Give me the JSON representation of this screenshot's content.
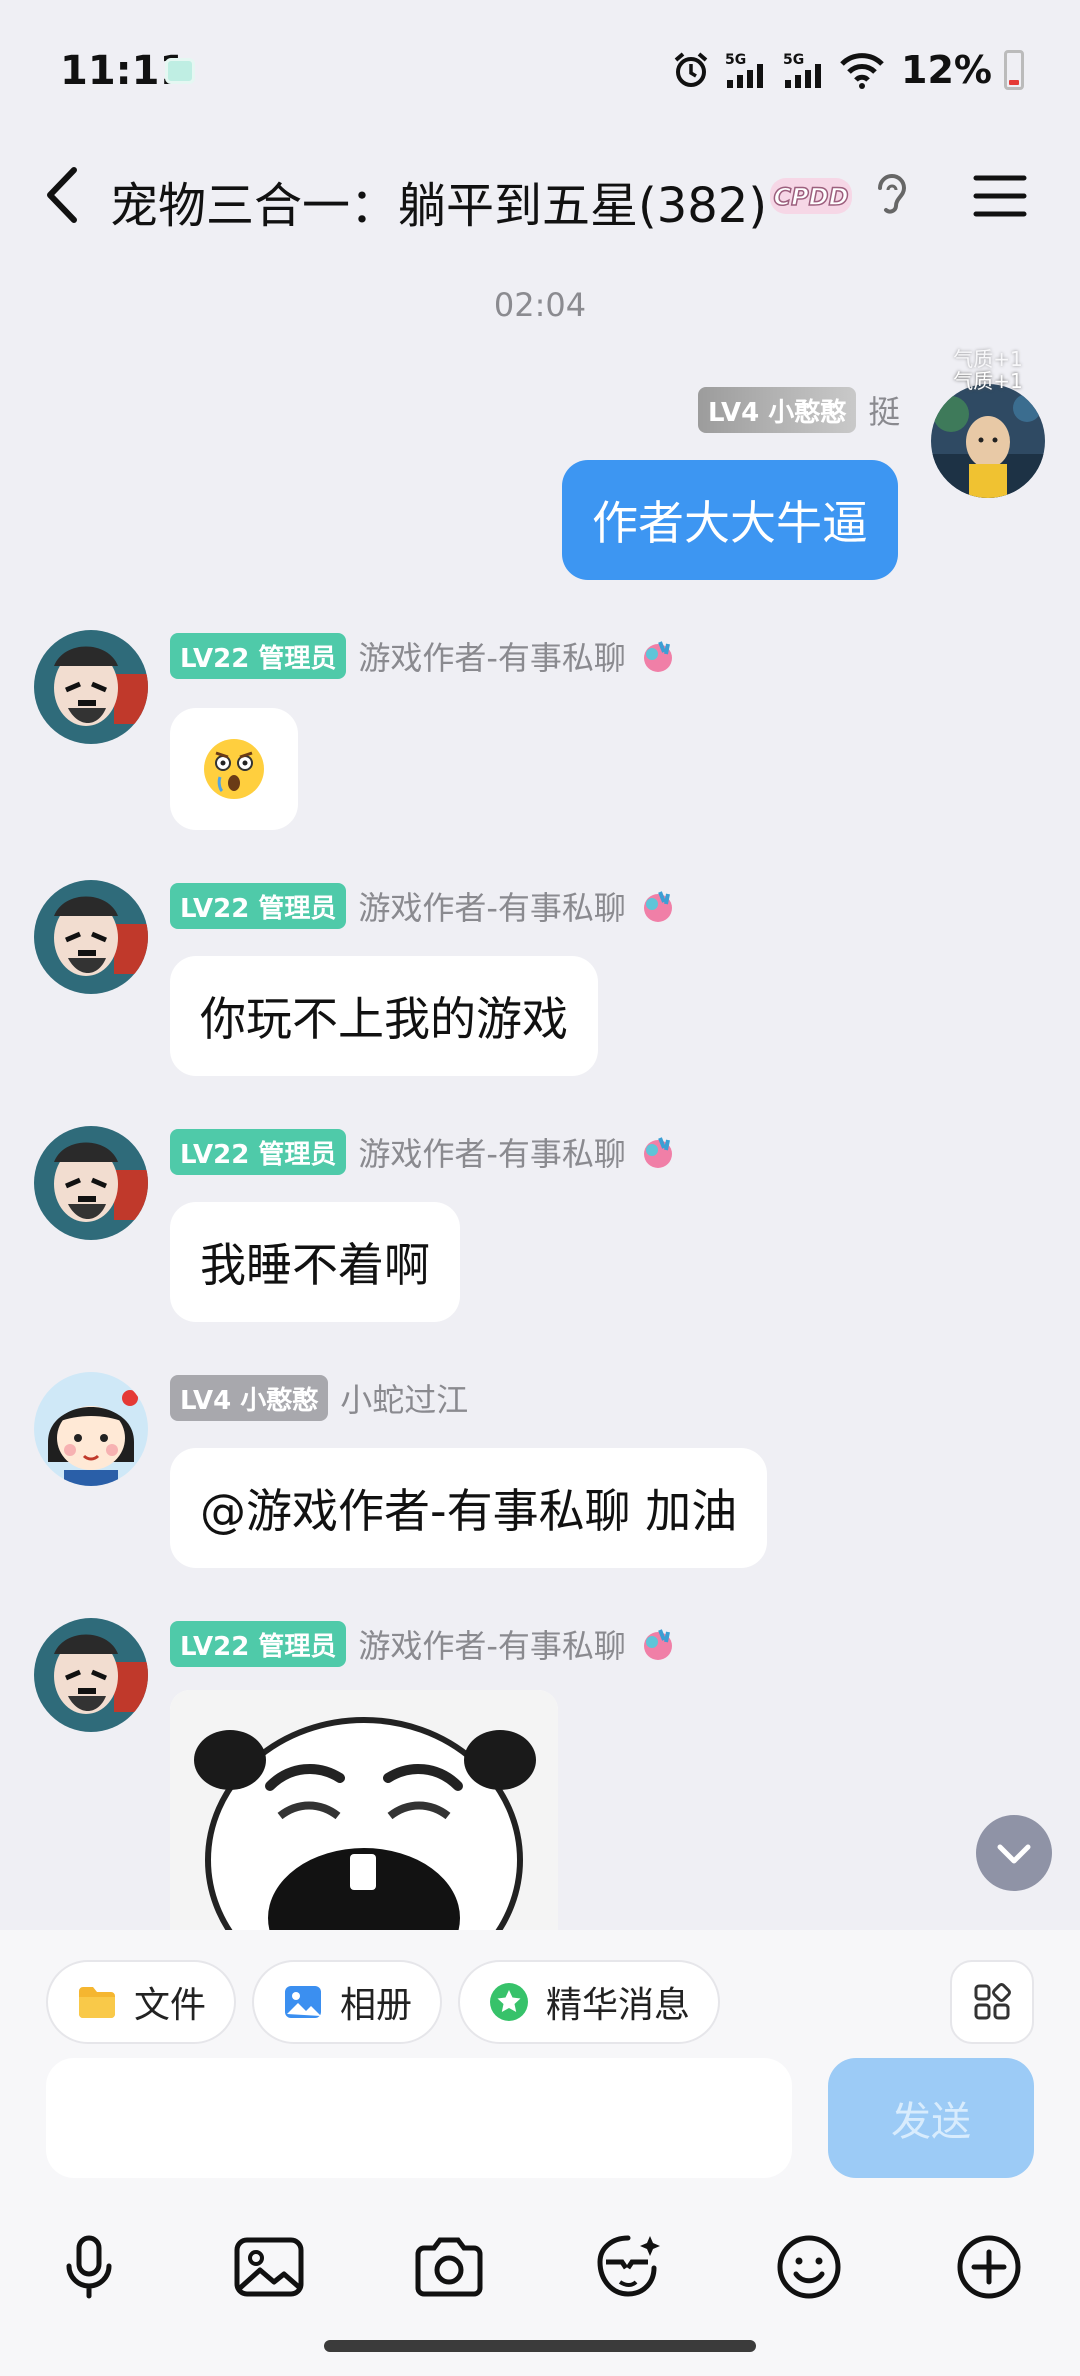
{
  "status_bar": {
    "time": "11:11",
    "network_1": "5G",
    "network_2": "5G",
    "battery": "12%"
  },
  "header": {
    "title": "宠物三合一：躺平到五星(382)",
    "cpdd_label": "CPDD"
  },
  "messages": {
    "timestamp": "02:04",
    "m0": {
      "side": "self",
      "badge": "LV4 小憨憨",
      "name": "挺",
      "avatar_overlay": "气质+1",
      "text": "作者大大牛逼"
    },
    "m1": {
      "badge": "LV22 管理员",
      "name": "游戏作者-有事私聊",
      "content": "shocked-emoji-icon"
    },
    "m2": {
      "badge": "LV22 管理员",
      "name": "游戏作者-有事私聊",
      "text": "你玩不上我的游戏"
    },
    "m3": {
      "badge": "LV22 管理员",
      "name": "游戏作者-有事私聊",
      "text": "我睡不着啊"
    },
    "m4": {
      "badge": "LV4 小憨憨",
      "name": "小蛇过江",
      "text": "@游戏作者-有事私聊 加油"
    },
    "m5": {
      "badge": "LV22 管理员",
      "name": "游戏作者-有事私聊",
      "content": "crying-panda-sticker"
    }
  },
  "quick_actions": {
    "file": "文件",
    "album": "相册",
    "featured": "精华消息"
  },
  "composer": {
    "value": "",
    "send_label": "发送"
  },
  "colors": {
    "self_bubble": "#3d96f2",
    "admin_badge": "#4fcaa9",
    "send_disabled": "#9ccbf6"
  }
}
